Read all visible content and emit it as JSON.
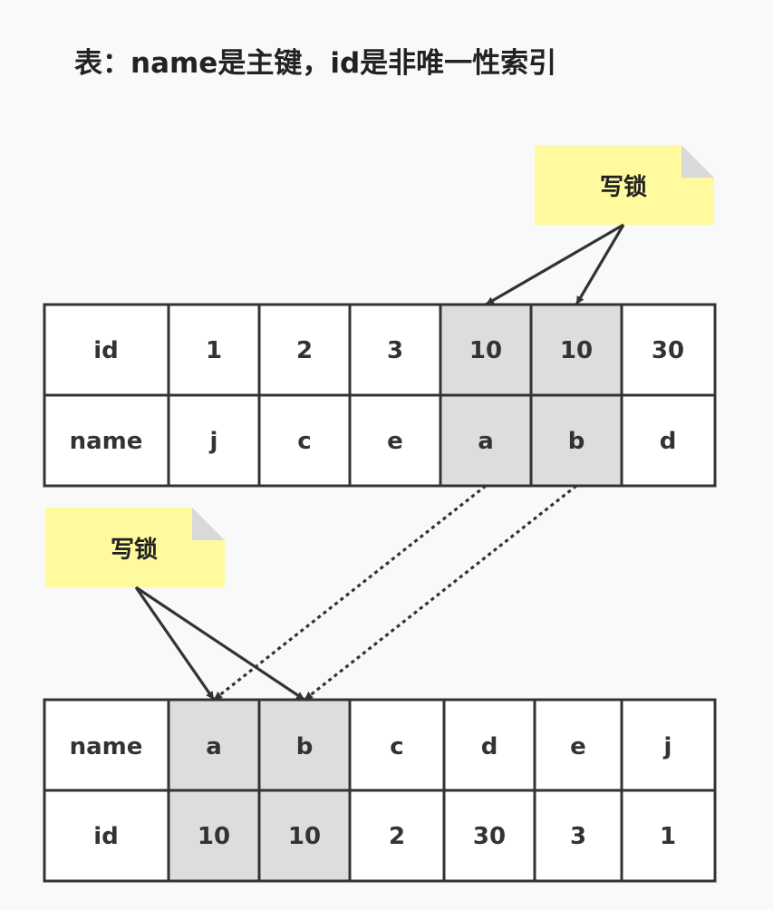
{
  "title": "表：name是主键，id是非唯一性索引",
  "colors": {
    "background": "#f9f9f9",
    "cell_fill": "#ffffff",
    "cell_highlight": "#dddddd",
    "grid_line": "#333333",
    "note_fill": "#fefa9d",
    "note_fold": "#d9d9d9",
    "arrow": "#333333"
  },
  "secondary_index": {
    "rows": [
      {
        "header": "id",
        "cells": [
          "1",
          "2",
          "3",
          "10",
          "10",
          "30"
        ]
      },
      {
        "header": "name",
        "cells": [
          "j",
          "c",
          "e",
          "a",
          "b",
          "d"
        ]
      }
    ],
    "locked_columns": [
      3,
      4
    ]
  },
  "primary_index": {
    "rows": [
      {
        "header": "name",
        "cells": [
          "a",
          "b",
          "c",
          "d",
          "e",
          "j"
        ]
      },
      {
        "header": "id",
        "cells": [
          "10",
          "10",
          "2",
          "30",
          "3",
          "1"
        ]
      }
    ],
    "locked_columns": [
      0,
      1
    ]
  },
  "notes": {
    "secondary_lock_note": "写锁",
    "primary_lock_note": "写锁"
  },
  "relations": {
    "secondary_note_targets": [
      3,
      4
    ],
    "primary_note_targets": [
      0,
      1
    ],
    "row_links": [
      {
        "from": 3,
        "to": 0,
        "style": "dotted"
      },
      {
        "from": 4,
        "to": 1,
        "style": "dotted"
      }
    ]
  }
}
